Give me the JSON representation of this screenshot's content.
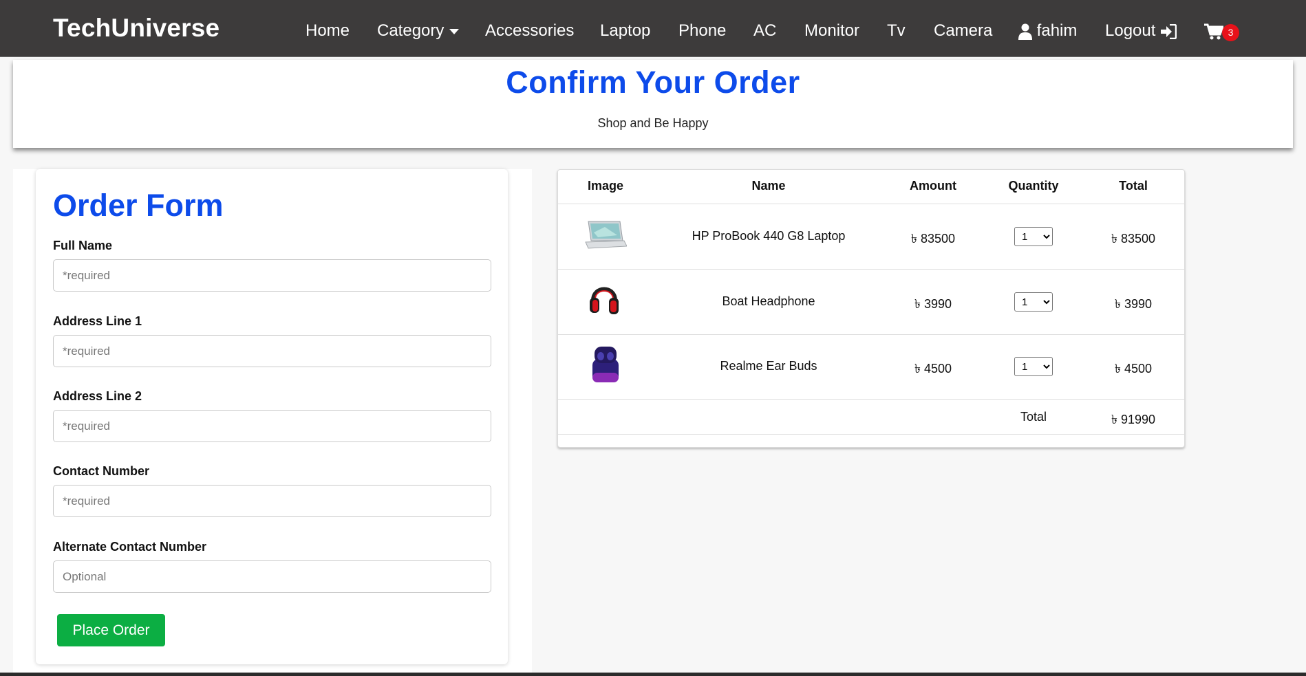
{
  "navbar": {
    "brand": "TechUniverse",
    "items": [
      {
        "label": "Home"
      },
      {
        "label": "Category"
      },
      {
        "label": "Accessories"
      },
      {
        "label": "Laptop"
      },
      {
        "label": "Phone"
      },
      {
        "label": "AC"
      },
      {
        "label": "Monitor"
      },
      {
        "label": "Tv"
      },
      {
        "label": "Camera"
      }
    ],
    "user": "fahim",
    "logout": "Logout",
    "cart_count": "3",
    "icons": {
      "category": "caret-down-icon",
      "user": "user-icon",
      "logout": "sign-in-icon",
      "cart": "shopping-cart-icon"
    }
  },
  "banner": {
    "title": "Confirm Your Order",
    "subtitle": "Shop and Be Happy"
  },
  "form": {
    "title": "Order Form",
    "fields": [
      {
        "label": "Full Name",
        "placeholder": "*required",
        "value": ""
      },
      {
        "label": "Address Line 1",
        "placeholder": "*required",
        "value": ""
      },
      {
        "label": "Address Line 2",
        "placeholder": "*required",
        "value": ""
      },
      {
        "label": "Contact Number",
        "placeholder": "*required",
        "value": ""
      },
      {
        "label": "Alternate Contact Number",
        "placeholder": "Optional",
        "value": ""
      }
    ],
    "submit_label": "Place Order"
  },
  "cart_table": {
    "headers": [
      "Image",
      "Name",
      "Amount",
      "Quantity",
      "Total"
    ],
    "rows": [
      {
        "image": "laptop-image",
        "name": "HP ProBook 440 G8 Laptop",
        "amount": "৳ 83500",
        "quantity": "1",
        "total": "৳ 83500"
      },
      {
        "image": "headphone-image",
        "name": "Boat Headphone",
        "amount": "৳ 3990",
        "quantity": "1",
        "total": "৳ 3990"
      },
      {
        "image": "earbuds-image",
        "name": "Realme Ear Buds",
        "amount": "৳ 4500",
        "quantity": "1",
        "total": "৳ 4500"
      }
    ],
    "total_label": "Total",
    "grand_total": "৳ 91990"
  },
  "colors": {
    "navbar_bg": "#3d3b3b",
    "accent_blue": "#0d4bea",
    "button_green": "#0cae43",
    "badge_red": "#e8121a"
  }
}
